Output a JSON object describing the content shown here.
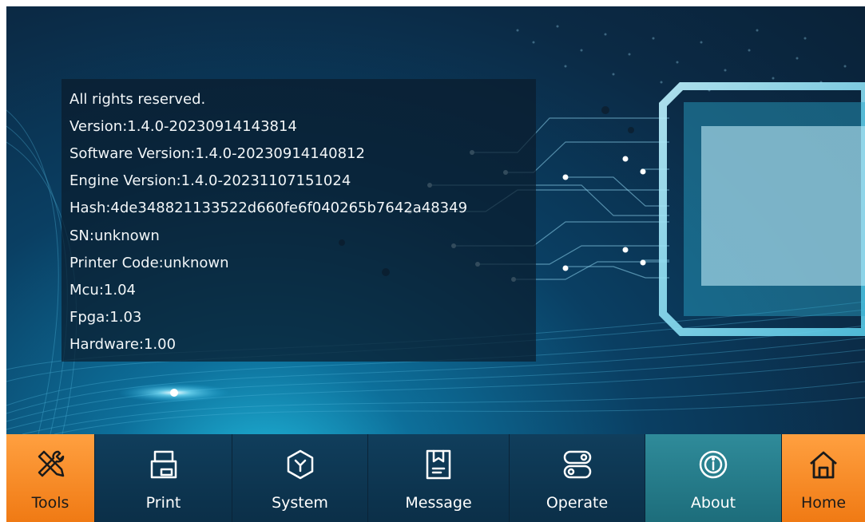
{
  "about_info": {
    "lines": [
      "All rights reserved.",
      "Version:1.4.0-20230914143814",
      "Software Version:1.4.0-20230914140812",
      "Engine Version:1.4.0-20231107151024",
      "Hash:4de348821133522d660fe6f040265b7642a48349",
      "SN:unknown",
      "Printer Code:unknown",
      "Mcu:1.04",
      "Fpga:1.03",
      "Hardware:1.00"
    ]
  },
  "nav": {
    "tools": "Tools",
    "print": "Print",
    "system": "System",
    "message": "Message",
    "operate": "Operate",
    "about": "About",
    "home": "Home",
    "active": "about"
  },
  "colors": {
    "accent_orange": "#f58a1f",
    "active_teal": "#25808e",
    "nav_blue": "#0e3a57"
  }
}
